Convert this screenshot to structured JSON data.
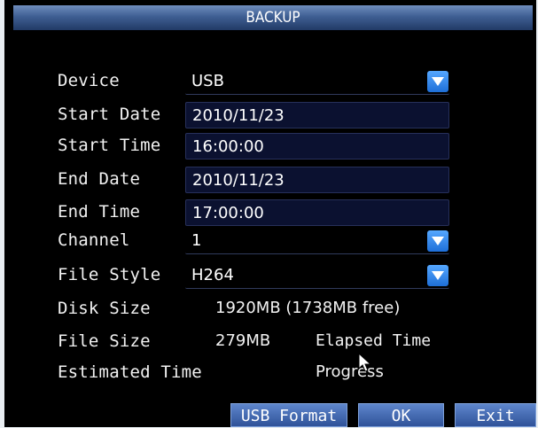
{
  "window": {
    "title": "BACKUP"
  },
  "form": {
    "device": {
      "label": "Device",
      "value": "USB"
    },
    "start_date": {
      "label": "Start Date",
      "value": "2010/11/23"
    },
    "start_time": {
      "label": "Start Time",
      "value": "16:00:00"
    },
    "end_date": {
      "label": "End Date",
      "value": "2010/11/23"
    },
    "end_time": {
      "label": "End Time",
      "value": "17:00:00"
    },
    "channel": {
      "label": "Channel",
      "value": "1"
    },
    "file_style": {
      "label": "File Style",
      "value": "H264"
    }
  },
  "info": {
    "disk_size_label": "Disk Size",
    "disk_size_value": "1920MB (1738MB free)",
    "file_size_label": "File Size",
    "file_size_value": "279MB",
    "elapsed_label": "Elapsed Time",
    "estimated_label": "Estimated Time",
    "progress_label": "Progress"
  },
  "buttons": {
    "usb_format": "USB Format",
    "ok": "OK",
    "exit": "Exit"
  },
  "icons": {
    "dropdown": "chevron-down-icon",
    "cursor": "mouse-pointer-icon"
  },
  "colors": {
    "title_bar": "#3f5f93",
    "dropdown_button": "#2f86f0",
    "button": "#4a6fb5"
  }
}
